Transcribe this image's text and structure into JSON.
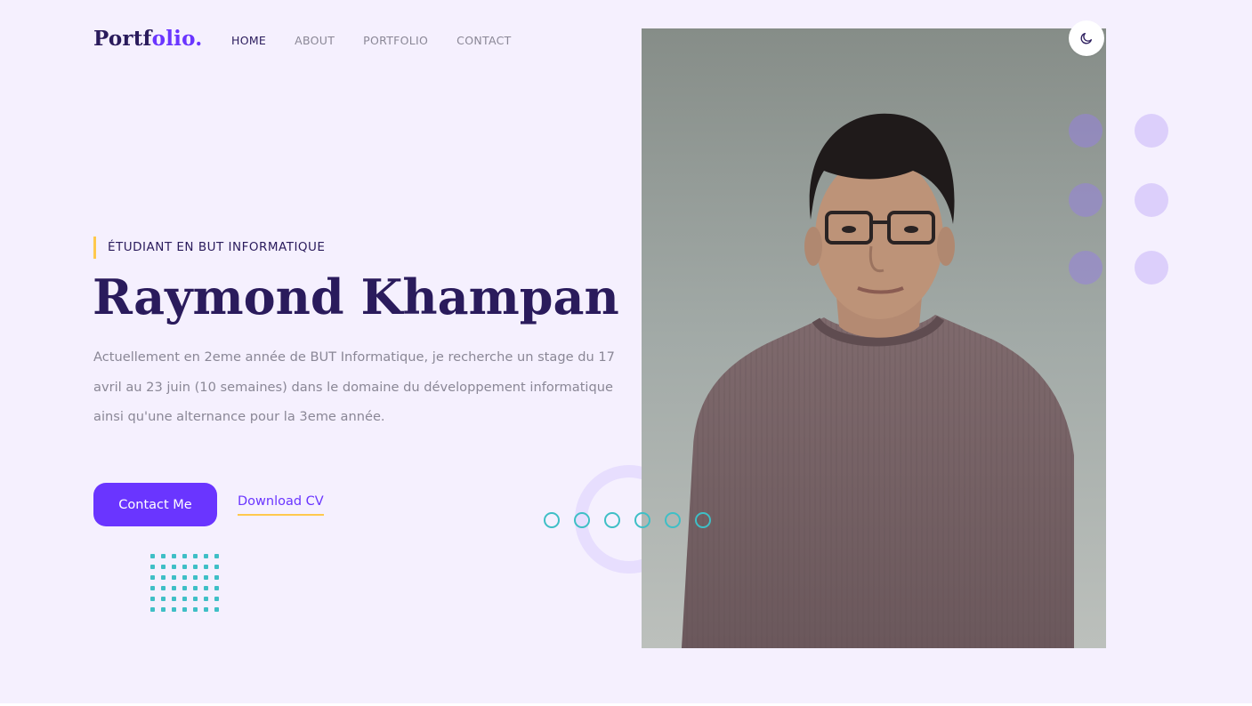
{
  "header": {
    "logo_main": "Portf",
    "logo_accent": "olio."
  },
  "nav": {
    "items": [
      {
        "label": "HOME",
        "active": true
      },
      {
        "label": "ABOUT",
        "active": false
      },
      {
        "label": "PORTFOLIO",
        "active": false
      },
      {
        "label": "CONTACT",
        "active": false
      }
    ]
  },
  "hero": {
    "eyebrow": "ÉTUDIANT EN BUT INFORMATIQUE",
    "name": "Raymond Khampan",
    "description": "Actuellement en 2eme année de BUT Informatique, je recherche un stage du 17 avril au 23 juin (10 semaines) dans le domaine du développement informatique ainsi qu'une alternance pour la 3eme année.",
    "contact_button": "Contact Me",
    "download_link": "Download CV"
  },
  "theme_toggle": {
    "icon": "moon-icon"
  },
  "colors": {
    "accent": "#6a35ff",
    "heading": "#2a1b5c",
    "highlight": "#ffc94d",
    "teal": "#3fbfc6",
    "background": "#f5f0fe"
  }
}
